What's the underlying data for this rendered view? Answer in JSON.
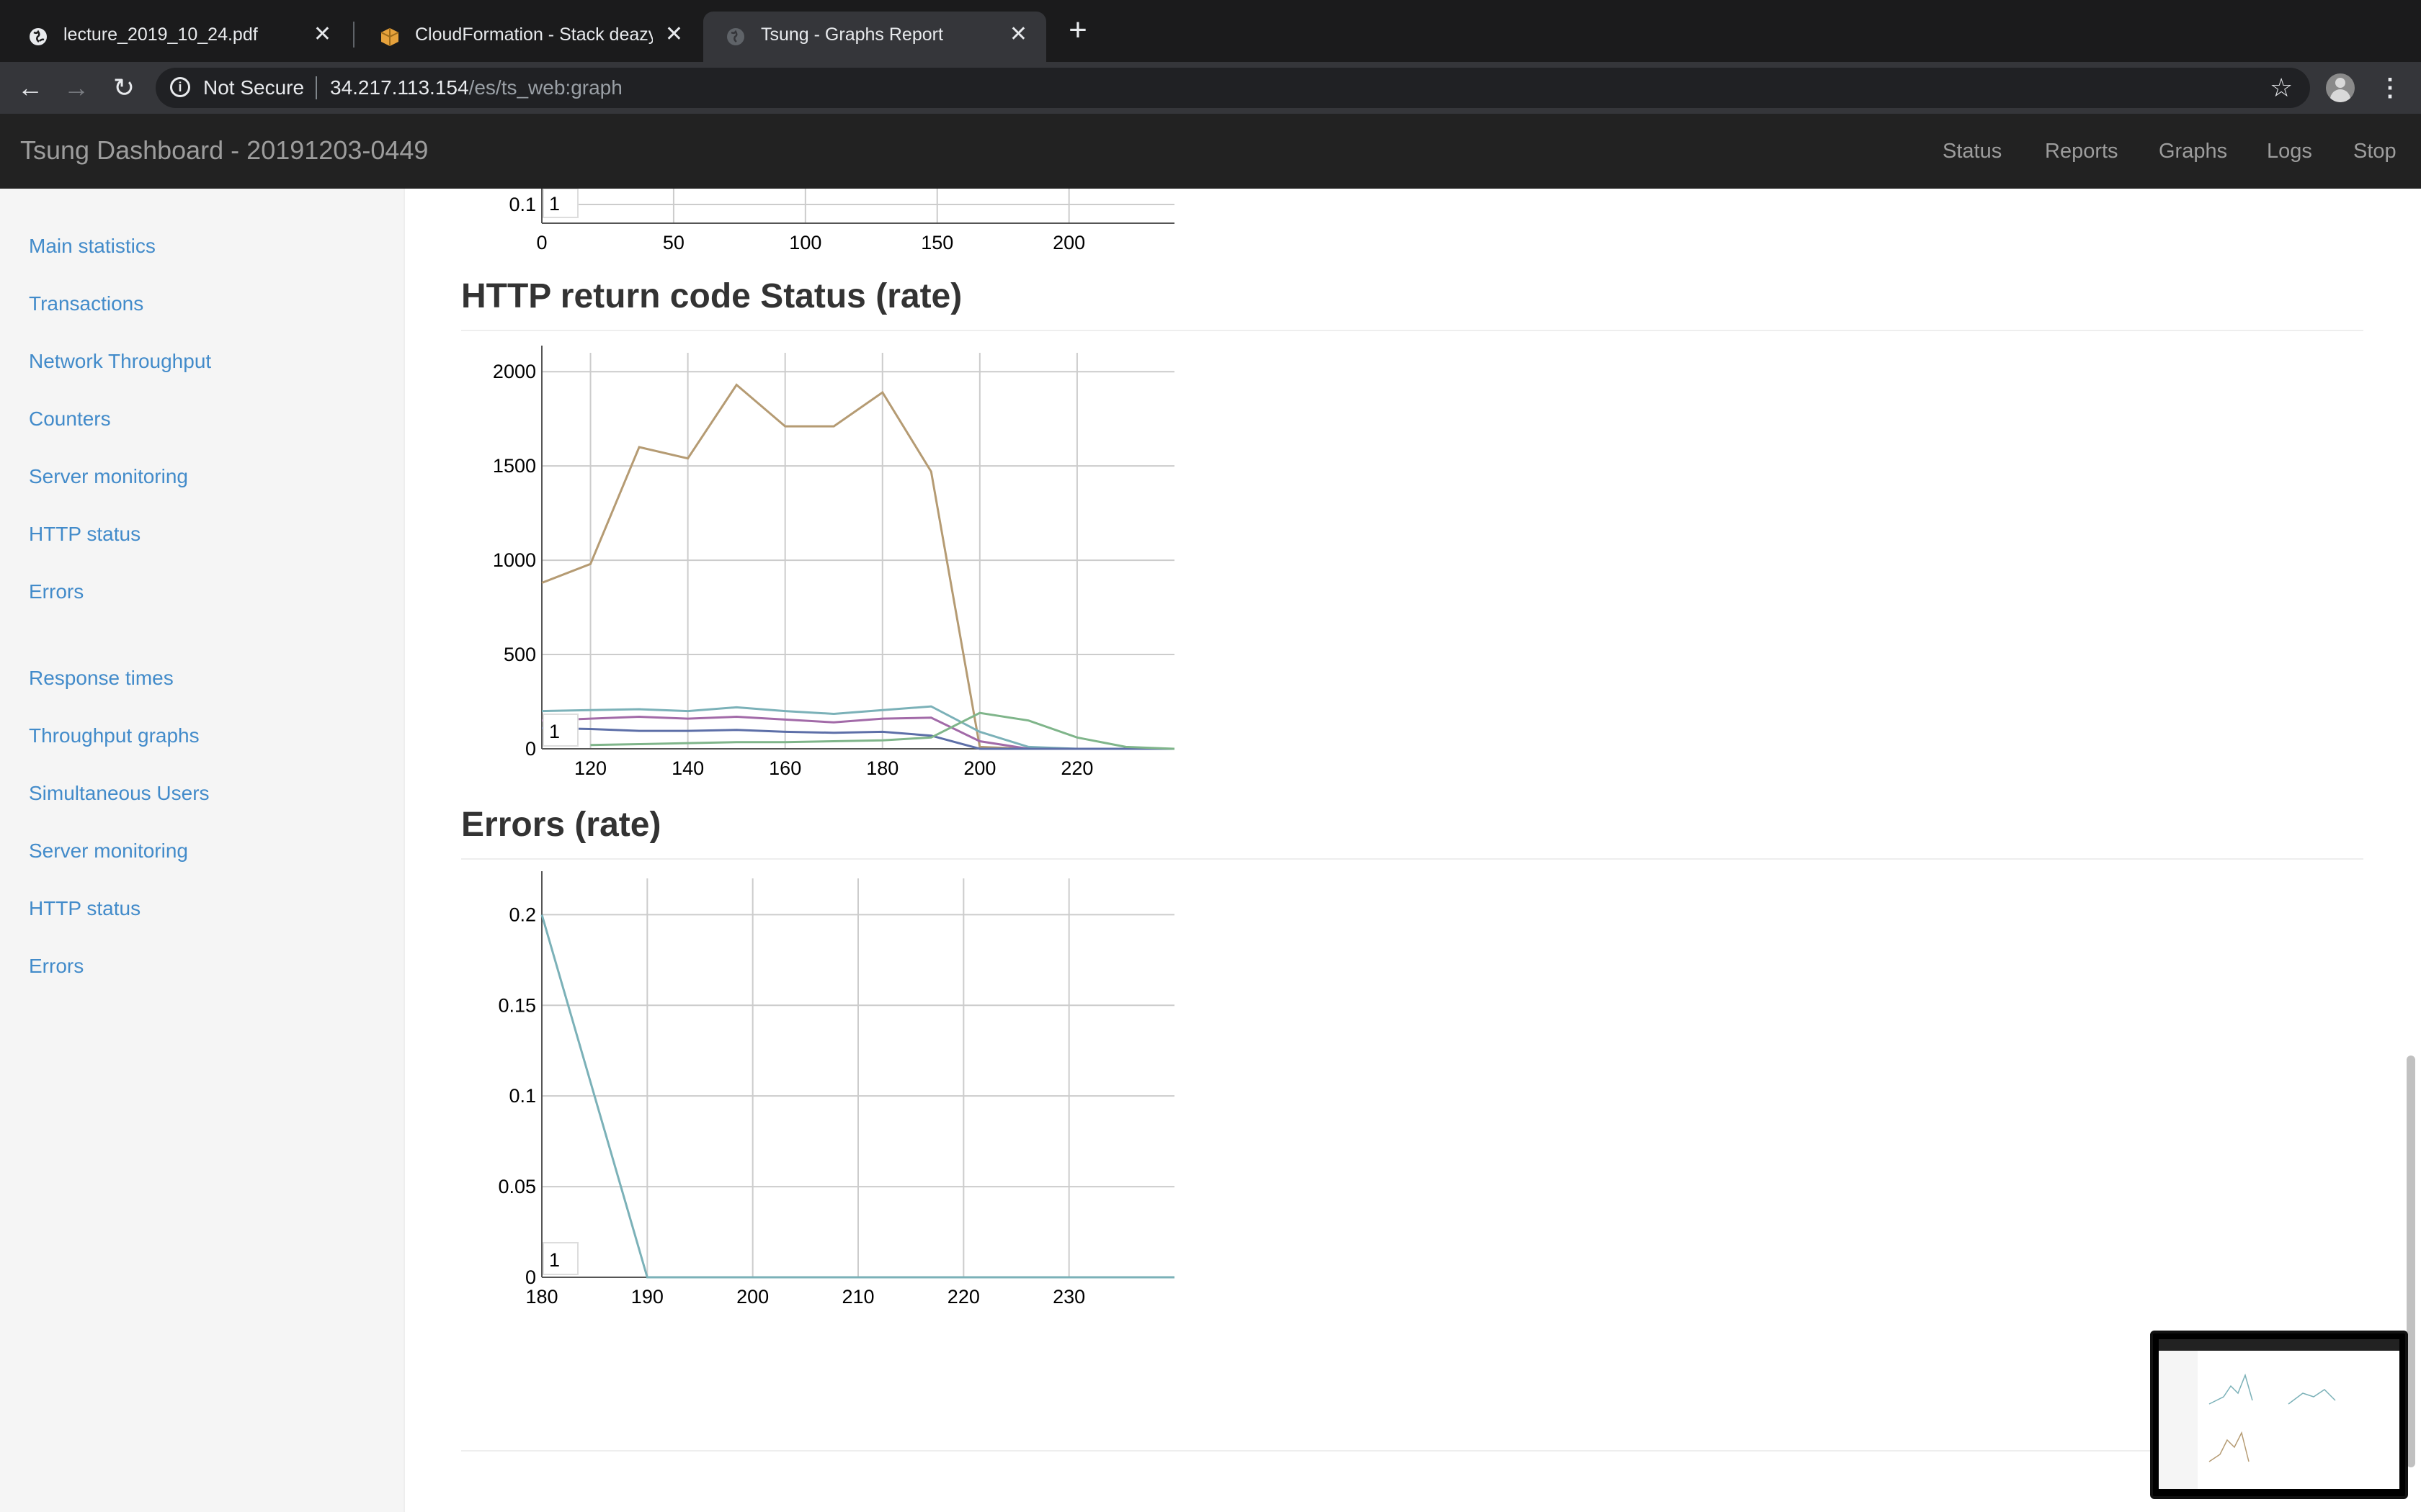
{
  "browser": {
    "tabs": [
      {
        "title": "lecture_2019_10_24.pdf",
        "icon": "globe-icon",
        "active": false
      },
      {
        "title": "CloudFormation - Stack deazySt",
        "icon": "aws-box-icon",
        "active": false
      },
      {
        "title": "Tsung - Graphs Report",
        "icon": "globe-icon",
        "active": true
      }
    ],
    "address": {
      "security_label": "Not Secure",
      "host": "34.217.113.154",
      "path": "/es/ts_web:graph"
    }
  },
  "navbar": {
    "brand": "Tsung Dashboard - 20191203-0449",
    "links": [
      "Status",
      "Reports",
      "Graphs",
      "Logs",
      "Stop"
    ]
  },
  "sidebar": {
    "group1": [
      "Main statistics",
      "Transactions",
      "Network Throughput",
      "Counters",
      "Server monitoring",
      "HTTP status",
      "Errors"
    ],
    "group2": [
      "Response times",
      "Throughput graphs",
      "Simultaneous Users",
      "Server monitoring",
      "HTTP status",
      "Errors"
    ]
  },
  "colors": {
    "link": "#428bca",
    "navbar_bg": "#222222",
    "series_200": "#b59b73",
    "series_teal": "#7bb1b8",
    "series_green": "#7fb58a",
    "series_purple": "#a26aa8",
    "series_blue": "#5d6fa8"
  },
  "main": {
    "sections": [
      {
        "title": "",
        "chart_data": {
          "type": "line",
          "title": "",
          "x_ticks": [
            0,
            50,
            100,
            150,
            200
          ],
          "y_visible_tick": "0.1",
          "legend_label": "1",
          "xlim": [
            0,
            240
          ]
        }
      },
      {
        "title": "HTTP return code Status (rate)",
        "chart_data": {
          "type": "line",
          "x": [
            110,
            120,
            130,
            140,
            150,
            160,
            170,
            180,
            190,
            200,
            210,
            220,
            230,
            240
          ],
          "xlim": [
            110,
            240
          ],
          "ylim": [
            0,
            2100
          ],
          "x_ticks": [
            120,
            140,
            160,
            180,
            200,
            220
          ],
          "y_ticks": [
            0,
            500,
            1000,
            1500,
            2000
          ],
          "legend_label": "1",
          "series": [
            {
              "color": "#b59b73",
              "values": [
                880,
                980,
                1600,
                1540,
                1930,
                1710,
                1710,
                1890,
                1470,
                10,
                0,
                0,
                0,
                0
              ]
            },
            {
              "color": "#7bb1b8",
              "values": [
                200,
                205,
                210,
                200,
                220,
                200,
                185,
                205,
                225,
                90,
                10,
                0,
                0,
                0
              ]
            },
            {
              "color": "#a26aa8",
              "values": [
                150,
                160,
                170,
                160,
                170,
                155,
                140,
                160,
                165,
                40,
                0,
                0,
                0,
                0
              ]
            },
            {
              "color": "#5d6fa8",
              "values": [
                110,
                105,
                95,
                95,
                100,
                90,
                85,
                90,
                70,
                0,
                0,
                0,
                0,
                0
              ]
            },
            {
              "color": "#7fb58a",
              "values": [
                null,
                20,
                25,
                30,
                35,
                35,
                40,
                45,
                60,
                190,
                150,
                60,
                10,
                0
              ]
            }
          ]
        }
      },
      {
        "title": "Errors (rate)",
        "chart_data": {
          "type": "line",
          "x": [
            180,
            190,
            200,
            210,
            220,
            230,
            240
          ],
          "xlim": [
            180,
            240
          ],
          "ylim": [
            0,
            0.22
          ],
          "x_ticks": [
            180,
            190,
            200,
            210,
            220,
            230
          ],
          "y_ticks": [
            0,
            0.05,
            0.1,
            0.15,
            0.2
          ],
          "legend_label": "1",
          "series": [
            {
              "color": "#7bb1b8",
              "values": [
                0.2,
                0,
                0,
                0,
                0,
                0,
                0
              ]
            }
          ]
        }
      }
    ]
  }
}
